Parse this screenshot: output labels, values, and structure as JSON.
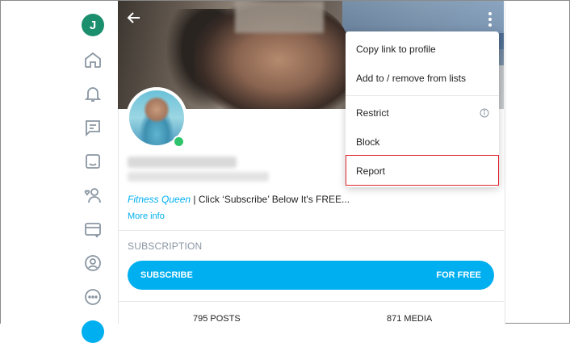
{
  "sidebar": {
    "avatar_initial": "J",
    "icons": [
      "home-icon",
      "bell-icon",
      "messages-icon",
      "collections-icon",
      "subscriptions-icon",
      "card-icon",
      "profile-icon",
      "more-icon"
    ]
  },
  "profile": {
    "bio_highlight": "Fitness Queen",
    "bio_rest": " | Click ‘Subscribe’ Below It's FREE...",
    "more_info": "More info"
  },
  "subscription": {
    "title": "SUBSCRIPTION",
    "button_left": "SUBSCRIBE",
    "button_right": "FOR FREE"
  },
  "stats": {
    "posts": "795 POSTS",
    "media": "871 MEDIA"
  },
  "menu": {
    "items": [
      "Copy link to profile",
      "Add to / remove from lists",
      "Restrict",
      "Block",
      "Report"
    ]
  },
  "colors": {
    "accent": "#00aff0",
    "avatar": "#1b8f6d",
    "online": "#2fc46b",
    "highlight_border": "#e0262e"
  }
}
